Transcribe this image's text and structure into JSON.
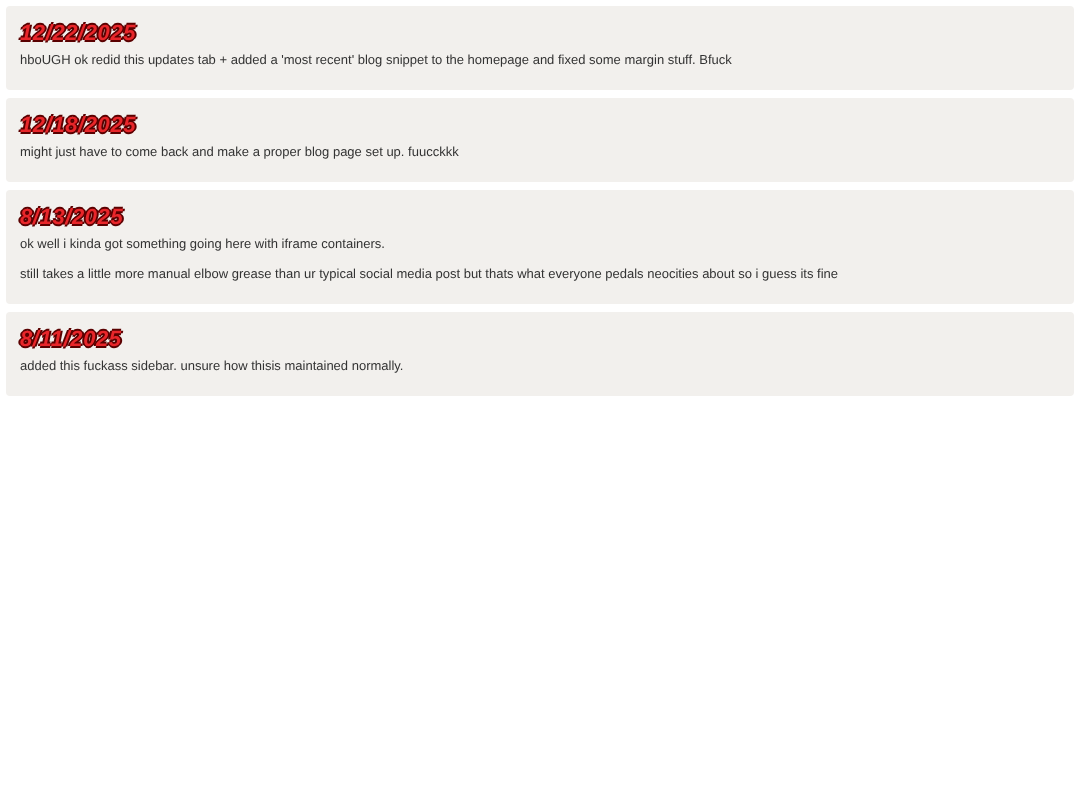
{
  "posts": [
    {
      "date": "12/22/2025",
      "paragraphs": [
        "hboUGH ok redid this updates tab + added a 'most recent' blog snippet to the homepage and fixed some margin stuff. Bfuck"
      ]
    },
    {
      "date": "12/18/2025",
      "paragraphs": [
        "might just have to come back and make a proper blog page set up. fuucckkk"
      ]
    },
    {
      "date": "8/13/2025",
      "paragraphs": [
        "ok well i kinda got something going here with iframe containers.",
        "still takes a little more manual elbow grease than ur typical social media post but thats what everyone pedals neocities about so i guess its fine"
      ]
    },
    {
      "date": "8/11/2025",
      "paragraphs": [
        "added this fuckass sidebar. unsure how thisis maintained normally."
      ]
    }
  ]
}
